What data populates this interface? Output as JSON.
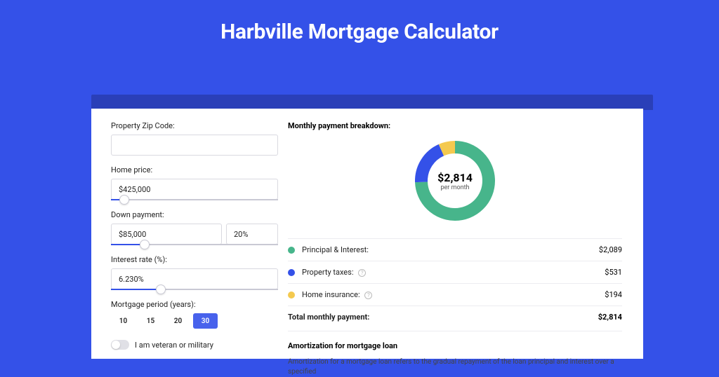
{
  "title": "Harbville Mortgage Calculator",
  "form": {
    "zip": {
      "label": "Property Zip Code:",
      "value": ""
    },
    "price": {
      "label": "Home price:",
      "value": "$425,000",
      "slider_pct": 8
    },
    "down": {
      "label": "Down payment:",
      "amount": "$85,000",
      "pct": "20%",
      "slider_pct": 20
    },
    "rate": {
      "label": "Interest rate (%):",
      "value": "6.230%",
      "slider_pct": 30
    },
    "period": {
      "label": "Mortgage period (years):",
      "options": [
        "10",
        "15",
        "20",
        "30"
      ],
      "selected": "30"
    },
    "veteran": {
      "label": "I am veteran or military",
      "checked": false
    }
  },
  "breakdown": {
    "title": "Monthly payment breakdown:",
    "center_amount": "$2,814",
    "center_label": "per month",
    "items": [
      {
        "label": "Principal & Interest:",
        "value": "$2,089",
        "color": "#47b58b",
        "help": false
      },
      {
        "label": "Property taxes:",
        "value": "$531",
        "color": "#3451e8",
        "help": true
      },
      {
        "label": "Home insurance:",
        "value": "$194",
        "color": "#f4c94f",
        "help": true
      }
    ],
    "total": {
      "label": "Total monthly payment:",
      "value": "$2,814"
    }
  },
  "chart_data": {
    "type": "pie",
    "title": "Monthly payment breakdown",
    "series": [
      {
        "name": "Principal & Interest",
        "value": 2089,
        "color": "#47b58b"
      },
      {
        "name": "Property taxes",
        "value": 531,
        "color": "#3451e8"
      },
      {
        "name": "Home insurance",
        "value": 194,
        "color": "#f4c94f"
      }
    ],
    "total": 2814
  },
  "amortization": {
    "title": "Amortization for mortgage loan",
    "text": "Amortization for a mortgage loan refers to the gradual repayment of the loan principal and interest over a specified"
  }
}
